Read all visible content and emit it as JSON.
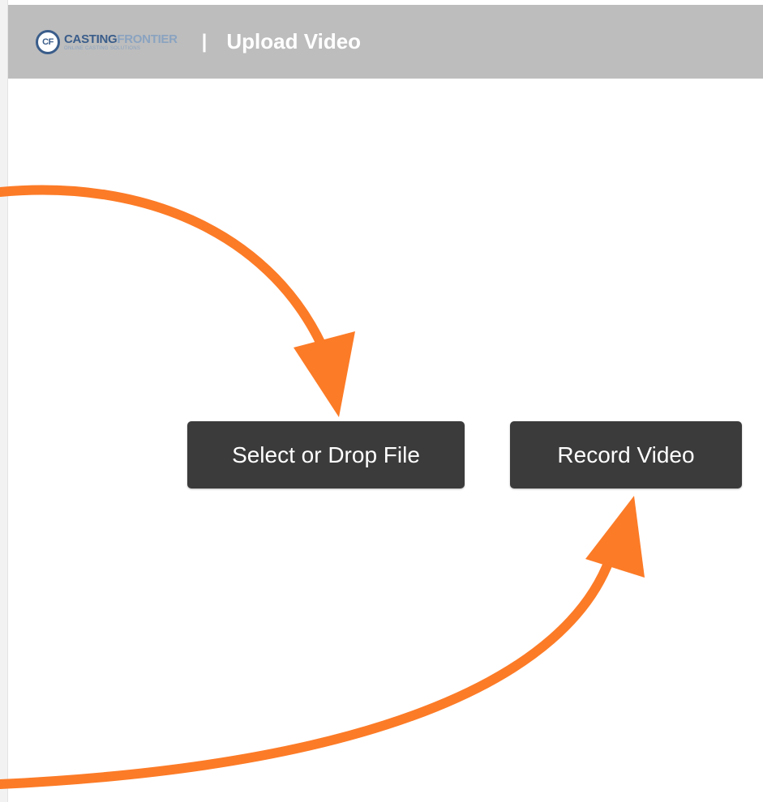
{
  "header": {
    "logo_badge": "CF",
    "logo_word1": "CASTING",
    "logo_word2": "FRONTIER",
    "logo_tagline": "ONLINE CASTING SOLUTIONS",
    "separator": "|",
    "title": "Upload Video"
  },
  "actions": {
    "select_label": "Select or Drop File",
    "record_label": "Record Video"
  },
  "colors": {
    "header_bg": "#bdbdbd",
    "button_bg": "#3b3b3b",
    "arrow": "#fc7b27",
    "brand_blue": "#3a5d8a"
  }
}
